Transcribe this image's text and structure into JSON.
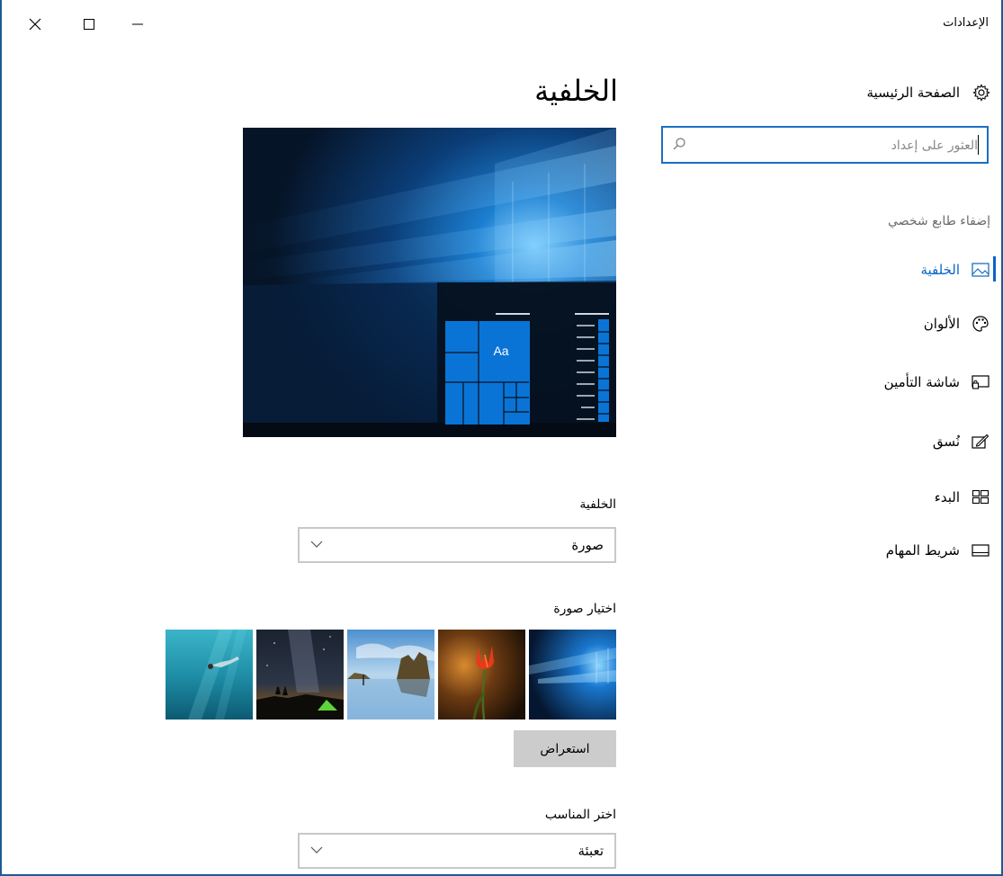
{
  "window": {
    "title": "الإعدادات"
  },
  "sidebar": {
    "home_label": "الصفحة الرئيسية",
    "search_placeholder": "العثور على إعداد",
    "section_label": "إضفاء طابع شخصي",
    "items": [
      {
        "label": "الخلفية",
        "icon": "picture-icon",
        "active": true
      },
      {
        "label": "الألوان",
        "icon": "palette-icon",
        "active": false
      },
      {
        "label": "شاشة التأمين",
        "icon": "lock-screen-icon",
        "active": false
      },
      {
        "label": "نُسق",
        "icon": "themes-icon",
        "active": false
      },
      {
        "label": "البدء",
        "icon": "start-icon",
        "active": false
      },
      {
        "label": "شريط المهام",
        "icon": "taskbar-icon",
        "active": false
      }
    ]
  },
  "main": {
    "page_title": "الخلفية",
    "preview_tile_text": "Aa",
    "background_label": "الخلفية",
    "background_value": "صورة",
    "choose_picture_label": "اختيار صورة",
    "pictures": [
      "windows-hero-wallpaper",
      "red-tulip-wallpaper",
      "beach-rocks-wallpaper",
      "night-sky-tent-wallpaper",
      "underwater-swimmer-wallpaper"
    ],
    "browse_label": "استعراض",
    "fit_label": "اختر المناسب",
    "fit_value": "تعبئة"
  },
  "colors": {
    "accent": "#0b63c5",
    "tile_blue": "#0a74d6"
  }
}
